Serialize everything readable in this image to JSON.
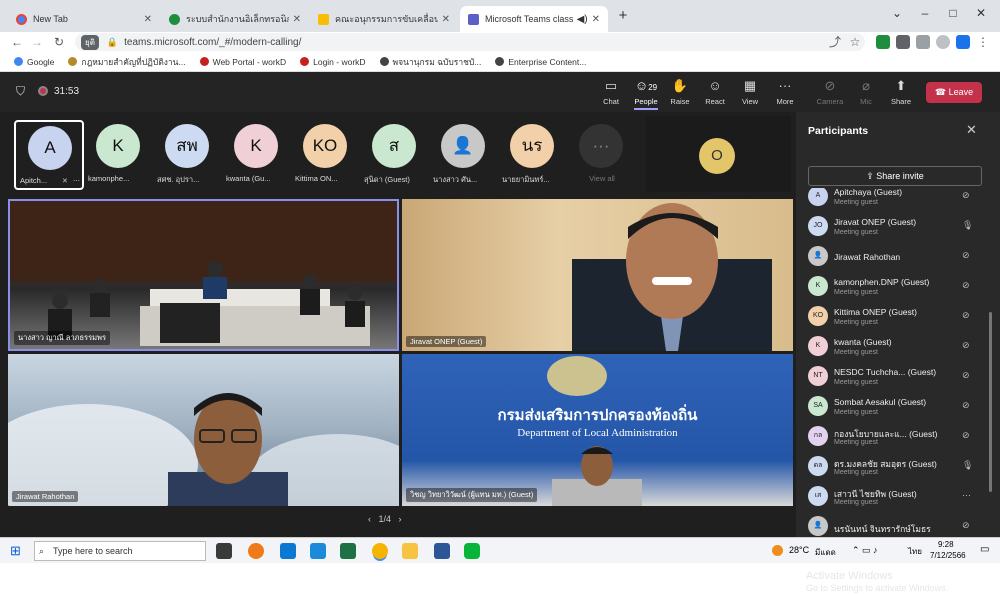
{
  "browser": {
    "tabs": [
      {
        "label": "New Tab"
      },
      {
        "label": "ระบบสำนักงานอิเล็กทรอนิกส์"
      },
      {
        "label": "คณะอนุกรรมการขับเคลื่อนการดำเนินงาน"
      },
      {
        "label": "Microsoft Teams classic"
      }
    ],
    "address": {
      "secure_chip": "ยุติ",
      "url": "teams.microsoft.com/_#/modern-calling/"
    },
    "bookmarks": [
      {
        "label": "Google"
      },
      {
        "label": "กฎหมายสำคัญที่ปฏิบัติงาน..."
      },
      {
        "label": "Web Portal - workD"
      },
      {
        "label": "Login - workD"
      },
      {
        "label": "พจนานุกรม ฉบับราชบั..."
      },
      {
        "label": "Enterprise Content..."
      }
    ]
  },
  "meeting": {
    "timer": "31:53",
    "toolbar": {
      "chat": "Chat",
      "people": "People",
      "people_count": "29",
      "raise": "Raise",
      "react": "React",
      "view": "View",
      "more": "More",
      "camera": "Camera",
      "mic": "Mic",
      "share": "Share",
      "leave": "Leave"
    },
    "strip": [
      {
        "initials": "A",
        "name": "Apitch...",
        "color": "#c7d3ef"
      },
      {
        "initials": "K",
        "name": "kamonphe...",
        "color": "#c9e8cf"
      },
      {
        "initials": "สพ",
        "name": "สศช. อุปรา...",
        "color": "#cddbf2"
      },
      {
        "initials": "K",
        "name": "kwanta (Gu...",
        "color": "#f0cfd7"
      },
      {
        "initials": "KO",
        "name": "Kittima ON...",
        "color": "#f2d0a9"
      },
      {
        "initials": "ส",
        "name": "สุนิดา (Guest)",
        "color": "#c9e8cf"
      },
      {
        "initials": "",
        "name": "นางสาว ศัน...",
        "color": "#c8c8c8"
      },
      {
        "initials": "นร",
        "name": "นายยามินทร์...",
        "color": "#f2d0a9"
      }
    ],
    "view_all": "View all",
    "featured_initials": "O",
    "videos": [
      {
        "label": "นางสาว ญาณี ลาภธรรมพร"
      },
      {
        "label": "Jiravat ONEP (Guest)"
      },
      {
        "label": "Jirawat Rahothan"
      },
      {
        "label": "วิชญ วิทยาวิวัฒน์ (ผู้แทน มท.) (Guest)"
      }
    ],
    "room_banner": {
      "thai": "กรมส่งเสริมการปกครองท้องถิ่น",
      "en": "Department of Local Administration"
    },
    "pager": {
      "prev": "‹",
      "label": "1/4",
      "next": "›"
    }
  },
  "participants_panel": {
    "title": "Participants",
    "share_invite": "Share invite",
    "items": [
      {
        "initials": "A",
        "name": "Apitchaya (Guest)",
        "status": "Meeting guest",
        "color": "#c7d3ef",
        "mic": "off"
      },
      {
        "initials": "JO",
        "name": "Jiravat ONEP (Guest)",
        "status": "Meeting guest",
        "color": "#cddbf2",
        "mic": "on"
      },
      {
        "initials": "",
        "name": "Jirawat Rahothan",
        "status": "",
        "color": "#c8c8c8",
        "mic": "off"
      },
      {
        "initials": "K",
        "name": "kamonphen.DNP (Guest)",
        "status": "Meeting guest",
        "color": "#c9e8cf",
        "mic": "off"
      },
      {
        "initials": "KO",
        "name": "Kittima ONEP (Guest)",
        "status": "Meeting guest",
        "color": "#f2d0a9",
        "mic": "off"
      },
      {
        "initials": "K",
        "name": "kwanta (Guest)",
        "status": "Meeting guest",
        "color": "#f0cfd7",
        "mic": "off"
      },
      {
        "initials": "NT",
        "name": "NESDC Tuchcha...    (Guest)",
        "status": "Meeting guest",
        "color": "#f0cfd7",
        "mic": "off"
      },
      {
        "initials": "SA",
        "name": "Sombat Aesakul (Guest)",
        "status": "Meeting guest",
        "color": "#c9e8cf",
        "mic": "off"
      },
      {
        "initials": "กล",
        "name": "กองนโยบายและแ...    (Guest)",
        "status": "Meeting guest",
        "color": "#e3d1f0",
        "mic": "off"
      },
      {
        "initials": "ดล",
        "name": "ดร.มงคลชัย สมอุดร (Guest)",
        "status": "Meeting guest",
        "color": "#cddbf2",
        "mic": "on"
      },
      {
        "initials": "เส",
        "name": "เสาวนี ไชยทิพ (Guest)",
        "status": "Meeting guest",
        "color": "#cddbf2",
        "mic": "more"
      },
      {
        "initials": "",
        "name": "นรนันทน์ จินทรารักษ์โมธร",
        "status": "",
        "color": "#c8c8c8",
        "mic": "off"
      }
    ],
    "activate_windows": [
      "Activate Windows",
      "Go to Settings to activate Windows."
    ]
  },
  "taskbar": {
    "search_placeholder": "Type here to search",
    "weather": "28°C",
    "weather_text": "มีแดด",
    "lang": "ไทย",
    "time": "9:28",
    "date": "7/12/2566"
  }
}
